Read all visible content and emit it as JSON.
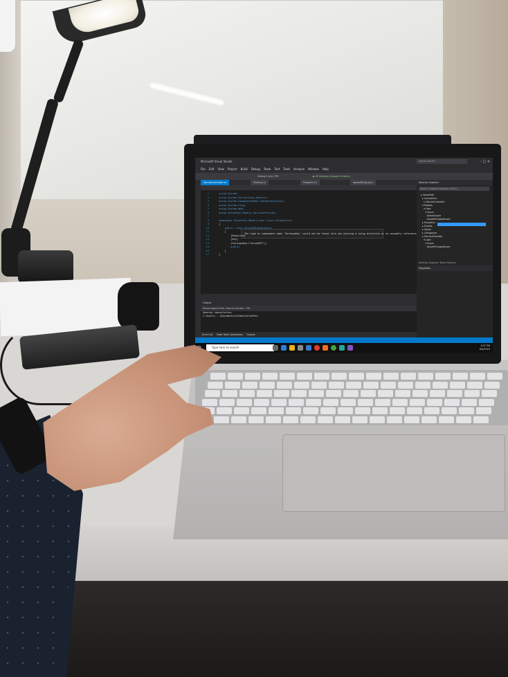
{
  "vs": {
    "window_title": "Microsoft Visual Studio",
    "search_placeholder": "Quick Launch",
    "window_buttons": "– □ ✕",
    "menu": [
      "File",
      "Edit",
      "View",
      "Project",
      "Build",
      "Debug",
      "Team",
      "Test",
      "Tools",
      "Analyze",
      "Window",
      "Help"
    ],
    "toolbar_config": "Debug  ▾  Any CPU",
    "toolbar_run": "▶ IIS Express (Google Chrome)",
    "tabs": [
      {
        "label": "ValuesController.cs",
        "active": true
      },
      {
        "label": "Startup.cs",
        "active": false
      },
      {
        "label": "Program.cs",
        "active": false
      },
      {
        "label": "appsettings.json",
        "active": false
      }
    ],
    "code_lines": [
      {
        "n": "1",
        "text": "using System;"
      },
      {
        "n": "2",
        "text": "using System.Collections.Generic;"
      },
      {
        "n": "3",
        "text": "using System.ComponentModel.DataAnnotations;"
      },
      {
        "n": "4",
        "text": "using System.Linq;"
      },
      {
        "n": "5",
        "text": "using System.Web;"
      },
      {
        "n": "6",
        "text": "using ValuePath.Models.ServiceProvider;"
      },
      {
        "n": "7",
        "text": ""
      },
      {
        "n": "8",
        "text": "namespace ValuePath.Models.User.Score.GlobalScore"
      },
      {
        "n": "9",
        "text": "{"
      },
      {
        "n": "10",
        "text": "    public class ValuePhGlobalScore"
      },
      {
        "n": "11",
        "text": "    {"
      },
      {
        "n": "12",
        "text": "        [Required]"
      },
      {
        "n": "13",
        "text": "        [Key]"
      },
      {
        "n": "14",
        "text": "        [ForeignKey(\"ValueOPE\")]"
      },
      {
        "n": "15",
        "text": "        public"
      },
      {
        "n": "16",
        "text": "    }"
      },
      {
        "n": "17",
        "text": "}"
      }
    ],
    "tooltip": "The type or namespace name 'ForeignKey' could not be found (are you missing a using directive or an assembly reference?)",
    "output_title": "Output",
    "output_source": "Show output from:  Source Control - Git",
    "output_lines": "Opening repositories:\nC:\\Users\\...\\Documents\\GitHub\\ValuePath",
    "solution_explorer_title": "Solution Explorer",
    "solution_search": "Search Solution Explorer (Ctrl+;)",
    "solution_tree": "▸ ValuePath\n  ▸ Controllers\n    ▸ ValuesController\n  ▾ Models\n    ▾ User\n      ▾ Score\n        GlobalScore\n        ValuePhGlobalScore\n  ▸ Providers\n  ▸ Scripts\n  ▸ Views\n  ▸ Categories\n  ▸ ServiceProvider\n    ▾ User\n      ▾ Score\n        ValuePhGlobalScore",
    "team_explorer_tab": "Solution Explorer   Team Explorer",
    "properties_title": "Properties",
    "bottom_tabs": [
      "Error List",
      "Data Tools Operations",
      "Output"
    ],
    "taskbar_search": "Type here to search",
    "tray_time": "3:07 PM",
    "tray_date": "6/4/2018"
  },
  "colors": {
    "vs_blue": "#007acc",
    "vs_dark": "#1e1e1e",
    "keyword_blue": "#569cd6"
  }
}
